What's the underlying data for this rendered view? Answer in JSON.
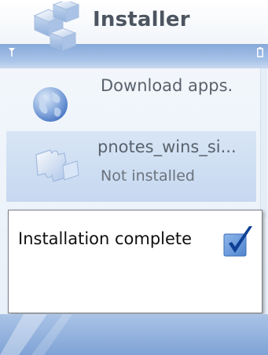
{
  "app": {
    "title": "Installer"
  },
  "icons": {
    "app": "installer-blocks-icon",
    "signal": "signal-icon",
    "battery": "battery-icon",
    "globe": "globe-icon",
    "puzzle": "puzzle-icon",
    "check": "checkmark-icon"
  },
  "list": {
    "items": [
      {
        "title": "Download apps.",
        "subtitle": ""
      },
      {
        "title": "pnotes_wins_si...",
        "subtitle": "Not installed"
      }
    ]
  },
  "dialog": {
    "message": "Installation complete"
  },
  "colors": {
    "accent": "#2f6fc6",
    "statusbar": "#9bbbe4",
    "highlight": "#cddcf2"
  }
}
